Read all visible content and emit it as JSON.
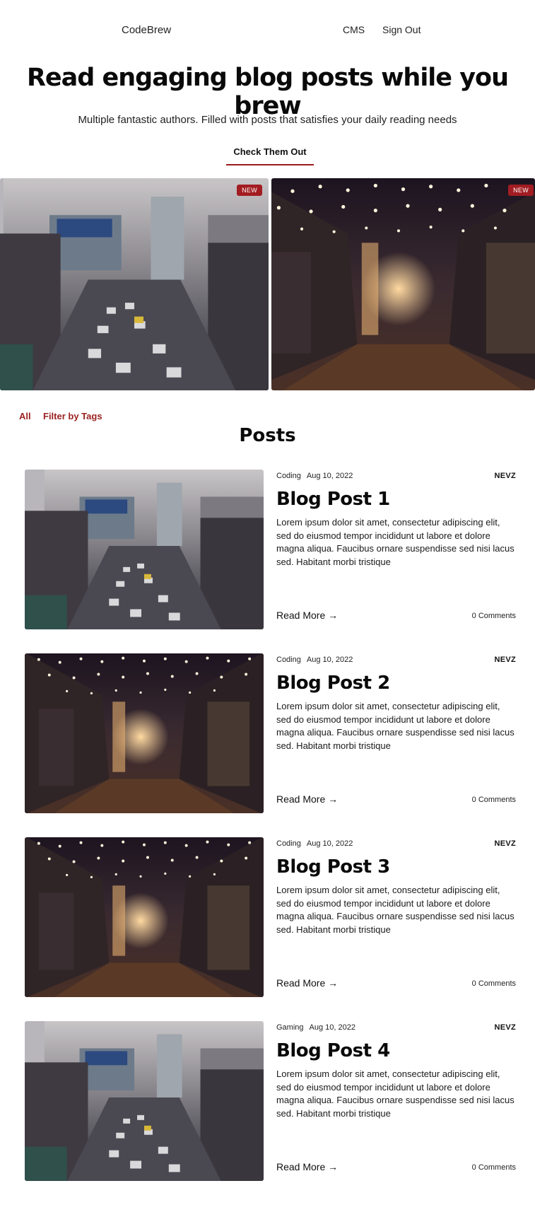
{
  "nav": {
    "brand": "CodeBrew",
    "links": {
      "cms": "CMS",
      "sign_out": "Sign Out"
    }
  },
  "hero": {
    "title": "Read engaging blog posts while you brew",
    "subtitle": "Multiple fantastic authors. Filled with posts that satisfies your daily reading needs",
    "cta": "Check Them Out"
  },
  "featured": [
    {
      "badge": "NEW",
      "image": "city-traffic-photo"
    },
    {
      "badge": "NEW",
      "image": "lit-alley-photo"
    }
  ],
  "filters": {
    "all": "All",
    "filter_by_tags": "Filter by Tags"
  },
  "posts_heading": "Posts",
  "posts": [
    {
      "tag": "Coding",
      "date": "Aug 10, 2022",
      "author": "NEVZ",
      "title": "Blog Post 1",
      "excerpt": "Lorem ipsum dolor sit amet, consectetur adipiscing elit, sed do eiusmod tempor incididunt ut labore et dolore magna aliqua. Faucibus ornare suspendisse sed nisi lacus sed. Habitant morbi tristique",
      "read_more": "Read More →",
      "comments": "0 Comments",
      "image": "city-traffic-photo"
    },
    {
      "tag": "Coding",
      "date": "Aug 10, 2022",
      "author": "NEVZ",
      "title": "Blog Post 2",
      "excerpt": "Lorem ipsum dolor sit amet, consectetur adipiscing elit, sed do eiusmod tempor incididunt ut labore et dolore magna aliqua. Faucibus ornare suspendisse sed nisi lacus sed. Habitant morbi tristique",
      "read_more": "Read More →",
      "comments": "0 Comments",
      "image": "lit-alley-photo"
    },
    {
      "tag": "Coding",
      "date": "Aug 10, 2022",
      "author": "NEVZ",
      "title": "Blog Post 3",
      "excerpt": "Lorem ipsum dolor sit amet, consectetur adipiscing elit, sed do eiusmod tempor incididunt ut labore et dolore magna aliqua. Faucibus ornare suspendisse sed nisi lacus sed. Habitant morbi tristique",
      "read_more": "Read More →",
      "comments": "0 Comments",
      "image": "lit-alley-photo"
    },
    {
      "tag": "Gaming",
      "date": "Aug 10, 2022",
      "author": "NEVZ",
      "title": "Blog Post 4",
      "excerpt": "Lorem ipsum dolor sit amet, consectetur adipiscing elit, sed do eiusmod tempor incididunt ut labore et dolore magna aliqua. Faucibus ornare suspendisse sed nisi lacus sed. Habitant morbi tristique",
      "read_more": "Read More →",
      "comments": "0 Comments",
      "image": "city-traffic-photo"
    }
  ],
  "colors": {
    "accent": "#9c1c1c",
    "badge": "#a21d22",
    "text": "#111111"
  }
}
